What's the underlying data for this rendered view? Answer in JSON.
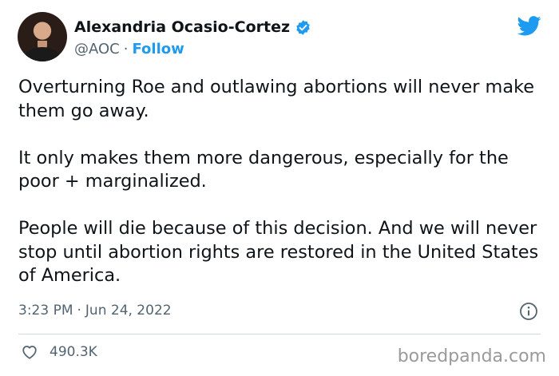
{
  "author": {
    "name": "Alexandria Ocasio-Cortez",
    "handle": "@AOC",
    "separator": "·",
    "follow_label": "Follow",
    "verified": true
  },
  "tweet": {
    "paragraphs": [
      "Overturning Roe and outlawing abortions will never make them go away.",
      "It only makes them more dangerous, especially for the poor + marginalized.",
      "People will die because of this decision. And we will never stop until abortion rights are restored in the United States of America."
    ],
    "time": "3:23 PM",
    "separator": "·",
    "date": "Jun 24, 2022",
    "likes": "490.3K"
  },
  "icons": {
    "verified": "verified-badge-icon",
    "logo": "twitter-bird-icon",
    "info": "info-icon",
    "like": "heart-icon"
  },
  "colors": {
    "accent": "#1d9bf0",
    "secondary_text": "#536471",
    "divider": "#cfd9de"
  },
  "watermark": "boredpanda.com"
}
